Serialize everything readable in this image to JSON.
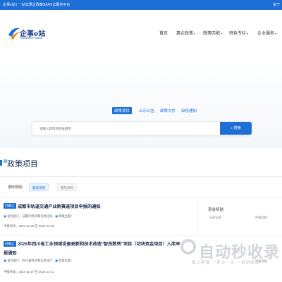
{
  "topbar": {
    "left_text": "企事e站 | 一站式惠企政策SAAS云服务平台",
    "right_text": "关于"
  },
  "logo": {
    "name": "企事e站",
    "sub": "Enterprise E Station"
  },
  "nav": {
    "items": [
      {
        "label": "首页",
        "caret": ""
      },
      {
        "label": "惠企政策",
        "caret": "▾"
      },
      {
        "label": "政策匹配",
        "caret": "▾"
      },
      {
        "label": "特色专栏",
        "caret": "▾"
      },
      {
        "label": "企业服务",
        "caret": "▾"
      }
    ]
  },
  "search": {
    "tabs": [
      "政策项目",
      "公示公告",
      "政策文件",
      "审核通知"
    ],
    "placeholder": "请输入政策项目关键字",
    "button": "搜索"
  },
  "section": {
    "title": "政策项目"
  },
  "sort": {
    "label": "排序规则：",
    "options": [
      "最新项目",
      "最热项目"
    ]
  },
  "cards": [
    {
      "tag": "已截止",
      "title": "成都市轨道交通产业新赛道项目申报的通知",
      "issuer_label": "发文部门：",
      "issuer": "成都市经济和信息化局",
      "level_label": "政策主题：",
      "level": "",
      "date_label": "申报时间：",
      "date": "2024-11-29 至 2024-12-09",
      "side_title": "资金奖励",
      "side_sub": "支持方式",
      "side_right": "申报流程"
    },
    {
      "tag": "已截止",
      "title": "2025年四川省工业领域设备更新和技术改造“智改数转”项目（切块资金项目）入库申",
      "title2": "报通知",
      "issuer_label": "发文部门：",
      "issuer": "四川省经济和信息化厅",
      "level_label": "政策主题：",
      "level": "",
      "date_label": "申报时间：",
      "date": "2024-11-27 至 2024-12-12",
      "side_title": "",
      "side_sub": "",
      "side_right": "申报流程"
    }
  ],
  "watermark": {
    "brand": "自动秒收录",
    "slogan": "做上链接 一来访一次 一自动收录"
  },
  "colors": {
    "primary": "#1d6fd6",
    "title": "#1a2b4c"
  }
}
